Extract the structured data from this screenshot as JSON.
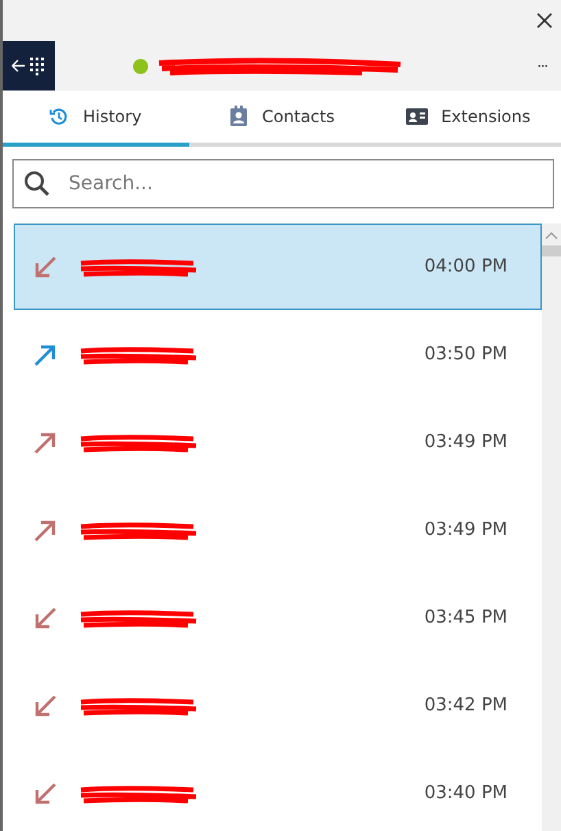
{
  "header": {
    "menu": "···"
  },
  "tabs": [
    {
      "label": "History",
      "selected": true
    },
    {
      "label": "Contacts",
      "selected": false
    },
    {
      "label": "Extensions",
      "selected": false
    }
  ],
  "search": {
    "placeholder": "Search..."
  },
  "calls": [
    {
      "kind": "incoming",
      "color": "#c0706e",
      "time": "04:00 PM",
      "selected": true
    },
    {
      "kind": "outgoing",
      "color": "#1e8fd6",
      "time": "03:50 PM",
      "selected": false
    },
    {
      "kind": "outgoing",
      "color": "#c0706e",
      "time": "03:49 PM",
      "selected": false
    },
    {
      "kind": "outgoing",
      "color": "#c0706e",
      "time": "03:49 PM",
      "selected": false
    },
    {
      "kind": "incoming",
      "color": "#c0706e",
      "time": "03:45 PM",
      "selected": false
    },
    {
      "kind": "incoming",
      "color": "#c0706e",
      "time": "03:42 PM",
      "selected": false
    },
    {
      "kind": "incoming",
      "color": "#c0706e",
      "time": "03:40 PM",
      "selected": false
    }
  ]
}
